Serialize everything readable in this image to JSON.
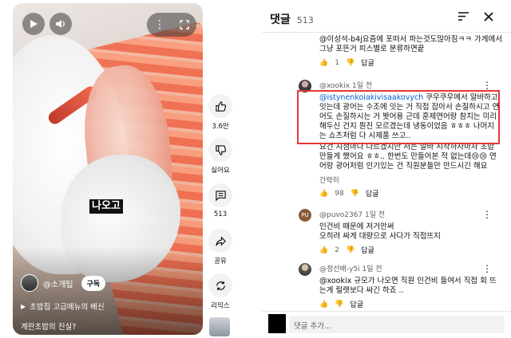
{
  "video": {
    "caption": "나오고",
    "channel_name": "@소개팁",
    "subscribe_label": "구독",
    "related_text": "초밥집 고급메뉴의 배신",
    "title": "계란초밥의 진실?"
  },
  "rail": {
    "likes": "3.6만",
    "dislike_label": "싫어요",
    "comments": "513",
    "share_label": "공유",
    "remix_label": "리믹스"
  },
  "comments_panel": {
    "title": "댓글",
    "count": "513",
    "comments": [
      {
        "author": "@이성석-b4j",
        "text": "요즘에 포떠서 파는것도많아짐ㅋㅋ 가게에서 그냥 포뜬거 피스별로 분류하면끝",
        "likes": "1",
        "reply_label": "답글"
      },
      {
        "author": "@xookix",
        "time": "1일 전",
        "mention": "@istynenkoiakivisaakovych",
        "highlighted_text": " 쿠우쿠우에서 알바하고 잇는데 광어는 수조에 잇는 거 직접 잡아서 손질하시고 연어도 손질하시는 거 봣어용 근데 훈제연어랑 참치는 미리 해두신 건지 뭔진 모르겠는데 냉동이었음 ㅎㅎㅎ 나머지는 쇼츠처럼 다 시제품 쓰고..",
        "rest_text": "요건 지점마다 다르겠지만 저는 알바 시작하자마자 초밥 만들게 했어요 ㅎㅎ.. 한번도 만들어본 적 없는데😢😢 연어랑 광어처럼 인기있는 건 직원분들만 만드시긴 해요",
        "more_label": "간략히",
        "likes": "98",
        "reply_label": "답글"
      },
      {
        "author": "@puvo2367",
        "time": "1일 전",
        "text": "인건비 때문에 저거안써\n오히려 싸게 대량으로 사다가 직접뜨지",
        "likes": "2",
        "reply_label": "답글"
      },
      {
        "author": "@정선배-y5i",
        "time": "1일 전",
        "text": "@xookix 규모가 나오면 직원 인건비 들여서 직접 회 뜨는게 릴렛보다 싸긴 하죠 ..",
        "reply_label": "답글"
      }
    ],
    "add_comment_placeholder": "댓글 추가..."
  }
}
